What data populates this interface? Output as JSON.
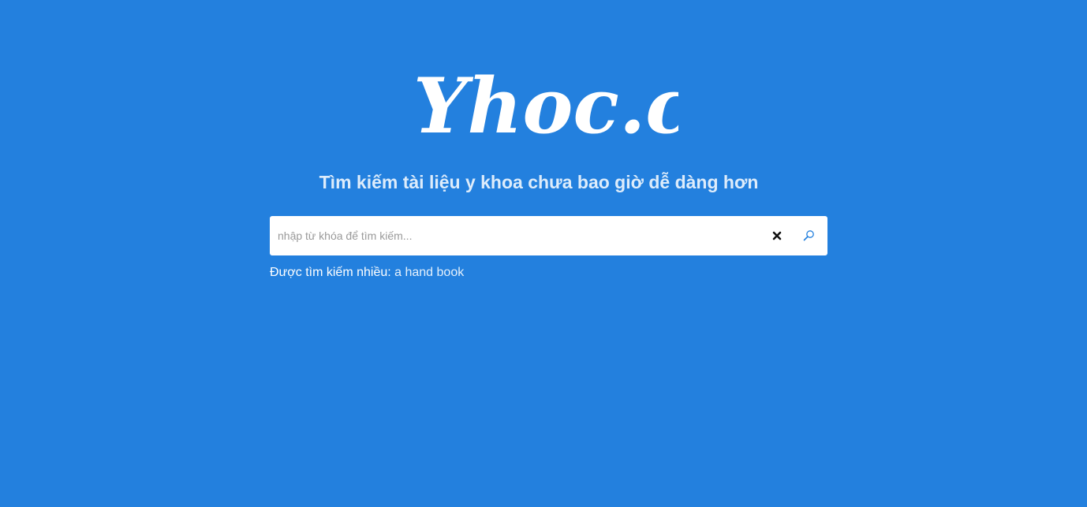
{
  "logo": {
    "text": "Yhoc.co"
  },
  "tagline": "Tìm kiếm tài liệu y khoa chưa bao giờ dễ dàng hơn",
  "search": {
    "placeholder": "nhập từ khóa để tìm kiếm...",
    "value": "",
    "clear_icon": "close-icon",
    "submit_icon": "search-icon"
  },
  "popular": {
    "label": "Được tìm kiếm nhiều:",
    "links": [
      "a hand book"
    ]
  },
  "colors": {
    "background": "#2380de",
    "search_icon": "#2380de"
  }
}
